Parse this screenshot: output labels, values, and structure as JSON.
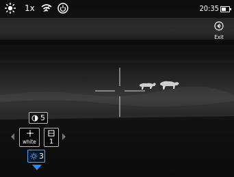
{
  "topbar": {
    "zoom": "1x",
    "clock": "20:35",
    "battery_level": 0.6,
    "icons": [
      "sun-icon",
      "wifi-icon",
      "power-icon"
    ]
  },
  "exit": {
    "label": "Exit",
    "icon": "exit-icon"
  },
  "menu": {
    "brightness_value": "5",
    "mode_label": "white",
    "mode_icon": "crosshair-mode-icon",
    "brightness_level": "1",
    "contrast_value": "3"
  },
  "colors": {
    "accent": "#2d8cf0",
    "text": "#ffffff"
  }
}
